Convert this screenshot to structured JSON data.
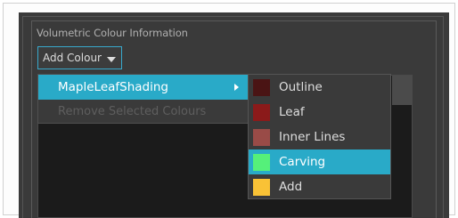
{
  "group": {
    "title": "Volumetric Colour Information"
  },
  "add_button": {
    "label": "Add Colour",
    "icon": "chevron-down-icon"
  },
  "menu": {
    "items": [
      {
        "label": "MapleLeafShading",
        "highlighted": true,
        "has_submenu": true,
        "icon": "chevron-right-icon"
      },
      {
        "label": "Remove Selected Colours",
        "disabled": true
      }
    ]
  },
  "submenu": {
    "items": [
      {
        "label": "Outline",
        "color": "#4a1414",
        "selected": false
      },
      {
        "label": "Leaf",
        "color": "#8b1a1a",
        "selected": false
      },
      {
        "label": "Inner Lines",
        "color": "#994b47",
        "selected": false
      },
      {
        "label": "Carving",
        "color": "#55f07a",
        "selected": true
      },
      {
        "label": "Add",
        "color": "#f9c236",
        "selected": false
      }
    ]
  },
  "colors": {
    "accent": "#29aac8",
    "button_border": "#38a8cc",
    "panel_bg": "#3a3a3a",
    "list_bg": "#1b1b1b"
  }
}
